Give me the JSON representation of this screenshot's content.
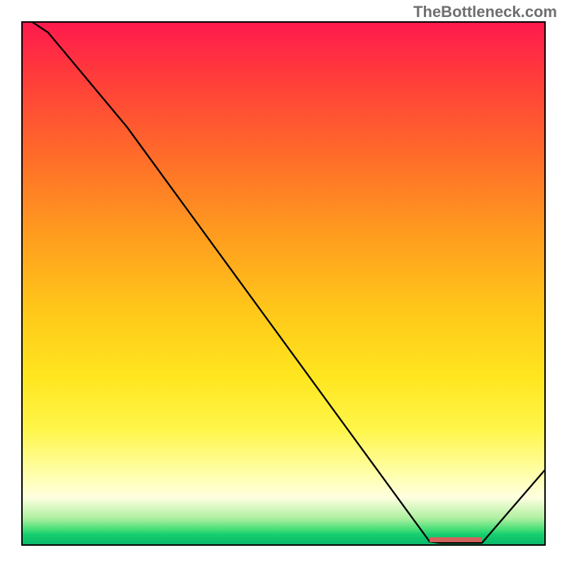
{
  "watermark": "TheBottleneck.com",
  "chart_data": {
    "type": "line",
    "title": "",
    "xlabel": "",
    "ylabel": "",
    "x": [
      0.0,
      0.05,
      0.2,
      0.78,
      0.8,
      0.88,
      1.0
    ],
    "values": [
      1.02,
      0.98,
      0.8,
      0.0,
      0.0,
      0.0,
      0.14
    ],
    "xlim": [
      0,
      1
    ],
    "ylim": [
      0,
      1
    ],
    "minimum_marker": {
      "x_start": 0.78,
      "x_end": 0.88,
      "y": 0.002
    },
    "background_gradient": {
      "stops": [
        {
          "pct": 0,
          "color": "#ff1a4d"
        },
        {
          "pct": 10,
          "color": "#ff3b3b"
        },
        {
          "pct": 25,
          "color": "#ff6a2a"
        },
        {
          "pct": 40,
          "color": "#ff9a1f"
        },
        {
          "pct": 55,
          "color": "#ffc71a"
        },
        {
          "pct": 68,
          "color": "#ffe61f"
        },
        {
          "pct": 78,
          "color": "#fff64a"
        },
        {
          "pct": 87,
          "color": "#ffffb0"
        },
        {
          "pct": 91,
          "color": "#ffffe0"
        },
        {
          "pct": 95,
          "color": "#aef0a0"
        },
        {
          "pct": 97,
          "color": "#4be07a"
        },
        {
          "pct": 98.2,
          "color": "#14ce6e"
        },
        {
          "pct": 100,
          "color": "#0ab86a"
        }
      ]
    }
  }
}
